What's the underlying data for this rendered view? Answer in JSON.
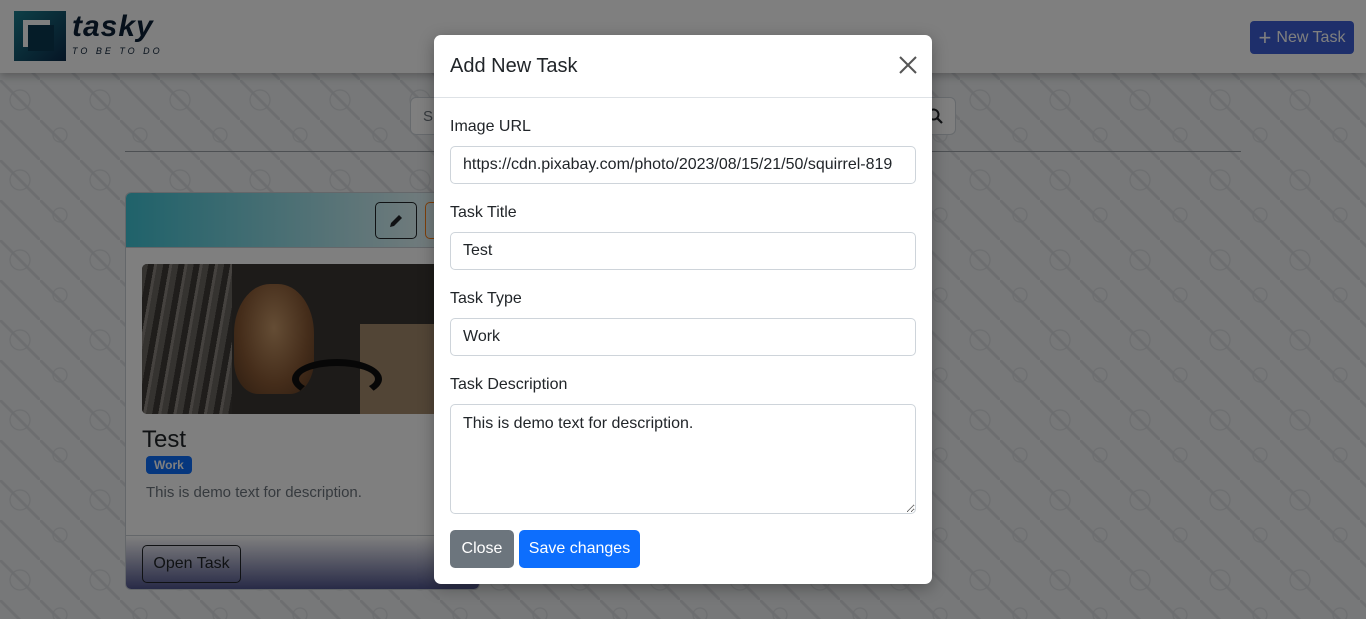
{
  "app": {
    "brand_name": "tasky",
    "brand_tagline": "TO BE TO DO"
  },
  "navbar": {
    "new_task_label": "New Task"
  },
  "search": {
    "partial_text": "S"
  },
  "card": {
    "title": "Test",
    "badge": "Work",
    "description": "This is demo text for description.",
    "open_task_label": "Open Task"
  },
  "modal": {
    "title": "Add New Task",
    "image_url": {
      "label": "Image URL",
      "value": "https://cdn.pixabay.com/photo/2023/08/15/21/50/squirrel-819"
    },
    "task_title": {
      "label": "Task Title",
      "value": "Test"
    },
    "task_type": {
      "label": "Task Type",
      "value": "Work"
    },
    "task_description": {
      "label": "Task Description",
      "value": "This is demo text for description."
    },
    "close_label": "Close",
    "save_label": "Save changes"
  },
  "colors": {
    "primary": "#0d6efd",
    "secondary": "#6c757d",
    "brand": "#0d2036"
  },
  "icons": {
    "close": "close-icon",
    "plus": "plus-icon",
    "search": "search-icon",
    "edit": "pencil-icon"
  }
}
